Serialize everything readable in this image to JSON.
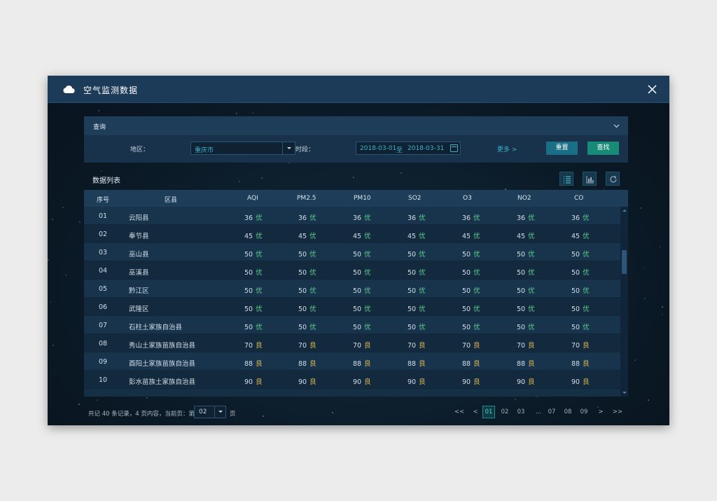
{
  "window": {
    "title": "空气监测数据"
  },
  "query": {
    "title": "查询",
    "region_label": "地区：",
    "region_value": "重庆市",
    "period_label": "时段：",
    "date_start": "2018-03-01",
    "date_sep": "至",
    "date_end": "2018-03-31",
    "more": "更多 >",
    "reset": "重置",
    "search": "查找"
  },
  "list": {
    "title": "数据列表",
    "columns": [
      "序号",
      "区县",
      "AQI",
      "PM2.5",
      "PM10",
      "SO2",
      "O3",
      "NO2",
      "CO"
    ],
    "rows": [
      {
        "no": "01",
        "district": "云阳县",
        "value": "36",
        "level": "优"
      },
      {
        "no": "02",
        "district": "奉节县",
        "value": "45",
        "level": "优"
      },
      {
        "no": "03",
        "district": "巫山县",
        "value": "50",
        "level": "优"
      },
      {
        "no": "04",
        "district": "巫溪县",
        "value": "50",
        "level": "优"
      },
      {
        "no": "05",
        "district": "黔江区",
        "value": "50",
        "level": "优"
      },
      {
        "no": "06",
        "district": "武隆区",
        "value": "50",
        "level": "优"
      },
      {
        "no": "07",
        "district": "石柱土家族自治县",
        "value": "50",
        "level": "优"
      },
      {
        "no": "08",
        "district": "秀山土家族苗族自治县",
        "value": "70",
        "level": "良"
      },
      {
        "no": "09",
        "district": "酉阳土家族苗族自治县",
        "value": "88",
        "level": "良"
      },
      {
        "no": "10",
        "district": "彭水苗族土家族自治县",
        "value": "90",
        "level": "良"
      }
    ]
  },
  "footer": {
    "summary": "共记 40 条记录，4 页内容，当前页：第",
    "page_value": "02",
    "page_suffix": "页",
    "pager": [
      "<<",
      "<",
      "01",
      "02",
      "03",
      "...",
      "07",
      "08",
      "09",
      ">",
      ">>"
    ],
    "active_page": "01"
  },
  "colors": {
    "good": "#5cc98a",
    "moderate": "#e0b94f",
    "accent": "#3fb2c8"
  },
  "icons": [
    "cloud-icon",
    "close-icon",
    "chevron-down-icon",
    "list-view-icon",
    "chart-view-icon",
    "refresh-icon",
    "calendar-icon"
  ]
}
